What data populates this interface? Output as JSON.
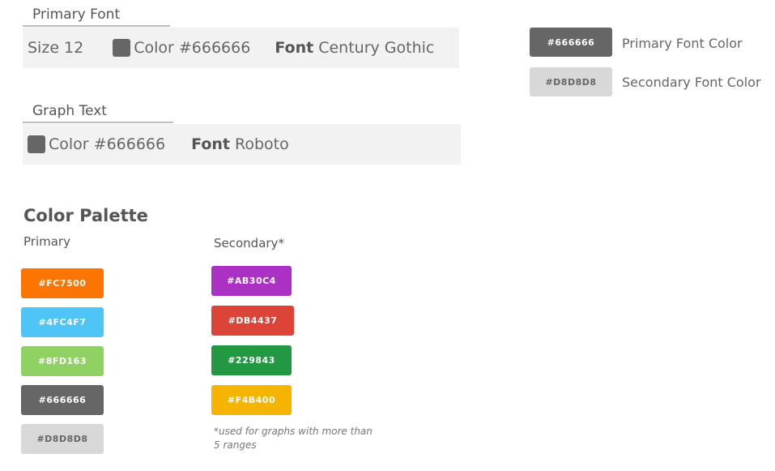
{
  "primary_font": {
    "heading": "Primary Font",
    "size_label": "Size 12",
    "color_label": "Color #666666",
    "font_key": "Font",
    "font_name": "Century Gothic",
    "swatch_color": "#666666"
  },
  "graph_text": {
    "heading": "Graph Text",
    "color_label": "Color #666666",
    "font_key": "Font",
    "font_name": "Roboto",
    "swatch_color": "#666666"
  },
  "font_colors": [
    {
      "chip": "#666666",
      "label": "Primary Font Color",
      "color": "#666666"
    },
    {
      "chip": "#D8D8D8",
      "label": "Secondary Font Color",
      "color": "#D8D8D8"
    }
  ],
  "palette": {
    "title": "Color Palette",
    "primary_label": "Primary",
    "secondary_label": "Secondary*",
    "primary": [
      {
        "label": "#FC7500",
        "color": "#FC7500"
      },
      {
        "label": "#4FC4F7",
        "color": "#4FC4F7"
      },
      {
        "label": "#8FD163",
        "color": "#8FD163"
      },
      {
        "label": "#666666",
        "color": "#666666"
      },
      {
        "label": "#D8D8D8",
        "color": "#D8D8D8"
      }
    ],
    "secondary": [
      {
        "label": "#AB30C4",
        "color": "#AB30C4"
      },
      {
        "label": "#DB4437",
        "color": "#DB4437"
      },
      {
        "label": "#229843",
        "color": "#229843"
      },
      {
        "label": "#F4B400",
        "color": "#F4B400"
      }
    ],
    "note": "*used for graphs with more than 5 ranges"
  }
}
